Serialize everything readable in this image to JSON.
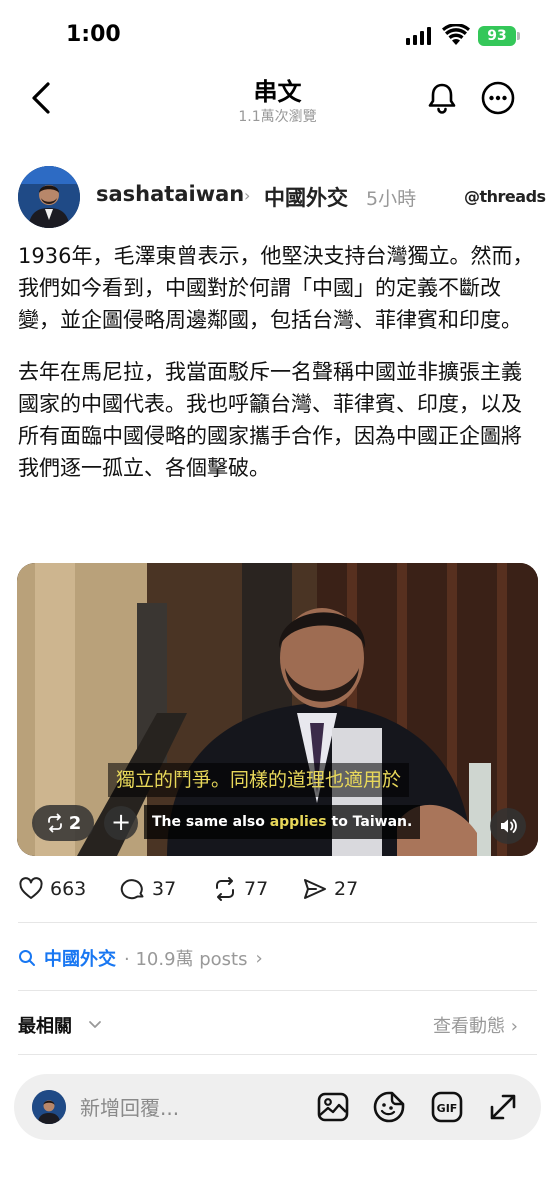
{
  "status": {
    "time": "1:00",
    "battery": "93"
  },
  "nav": {
    "title": "串文",
    "views": "1.1萬次瀏覽"
  },
  "post": {
    "username": "sashataiwan",
    "topic": "中國外交",
    "time": "5小時",
    "brand": "threads",
    "paragraphs": [
      "1936年，毛澤東曾表示，他堅決支持台灣獨立。然而，我們如今看到，中國對於何謂「中國」的定義不斷改變，並企圖侵略周邊鄰國，包括台灣、菲律賓和印度。",
      "去年在馬尼拉，我當面駁斥一名聲稱中國並非擴張主義國家的中國代表。我也呼籲台灣、菲律賓、印度，以及所有面臨中國侵略的國家攜手合作，因為中國正企圖將我們逐一孤立、各個擊破。"
    ]
  },
  "video": {
    "subtitle_zh": "獨立的鬥爭。同樣的道理也適用於",
    "subtitle_en_pre": "The same also ",
    "subtitle_en_hl": "applies",
    "subtitle_en_post": " to Taiwan.",
    "repost_count": "2"
  },
  "actions": {
    "likes": "663",
    "comments": "37",
    "reposts": "77",
    "shares": "27"
  },
  "topic_row": {
    "name": "中國外交",
    "count": "· 10.9萬 posts",
    "chevron": "›"
  },
  "sort": {
    "label": "最相關",
    "activity": "查看動態 ›"
  },
  "composer": {
    "placeholder": "新增回覆..."
  },
  "colors": {
    "link": "#1877f2",
    "battery": "#34c759",
    "subtitle": "#e8d85a"
  }
}
